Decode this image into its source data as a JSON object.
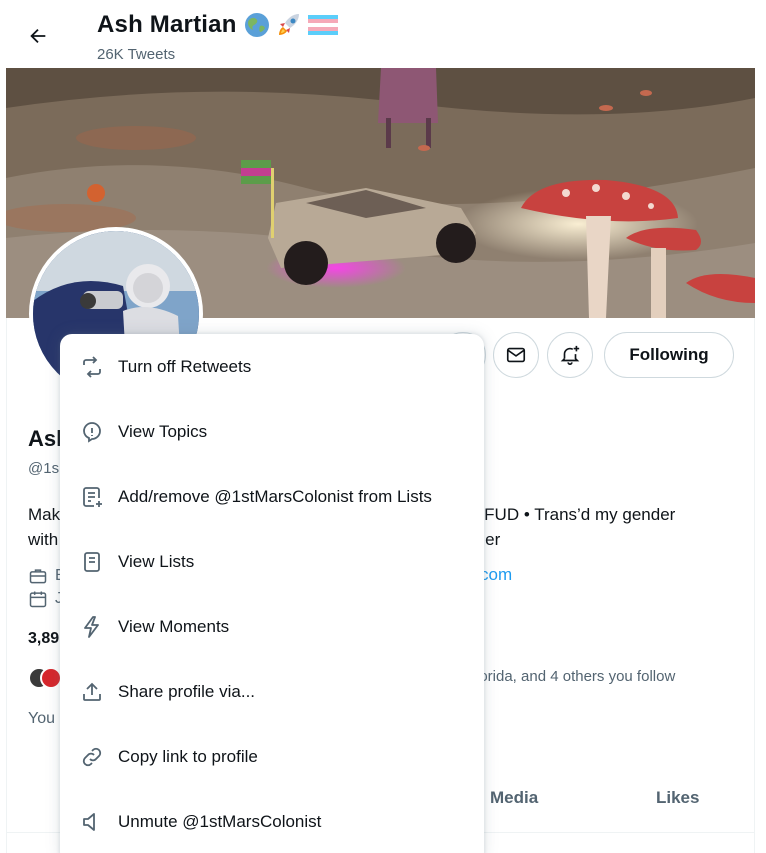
{
  "header": {
    "title": "Ash Martian",
    "tweet_count": "26K Tweets",
    "title_emoji": [
      "globe-emoji",
      "rocket-emoji",
      "trans-flag-emoji"
    ]
  },
  "profile": {
    "name_fragment": "Ash",
    "handle_fragment": "@1s",
    "bio_line1_left": "Mak",
    "bio_line1_right": "g FUD • Trans’d my gender",
    "bio_line2_left": "with",
    "bio_line2_right": "rner",
    "meta1_fragment": "E",
    "meta2_fragment": "J",
    "link_fragment": "com",
    "stats_fragment": "3,89",
    "followers_you_know": "lorida, and 4 others you follow",
    "you_fragment": "You",
    "following_button": "Following"
  },
  "tabs": {
    "media": "Media",
    "likes": "Likes"
  },
  "menu": {
    "items": [
      {
        "label": "Turn off Retweets",
        "icon": "retweet-icon"
      },
      {
        "label": "View Topics",
        "icon": "topics-icon"
      },
      {
        "label": "Add/remove @1stMarsColonist from Lists",
        "icon": "list-add-icon"
      },
      {
        "label": "View Lists",
        "icon": "list-icon"
      },
      {
        "label": "View Moments",
        "icon": "moments-icon"
      },
      {
        "label": "Share profile via...",
        "icon": "share-icon"
      },
      {
        "label": "Copy link to profile",
        "icon": "link-icon"
      },
      {
        "label": "Unmute @1stMarsColonist",
        "icon": "speaker-icon"
      }
    ]
  },
  "colors": {
    "accent": "#1d9bf0",
    "text_primary": "#0f1419",
    "text_secondary": "#536471",
    "border": "#cfd9de"
  }
}
